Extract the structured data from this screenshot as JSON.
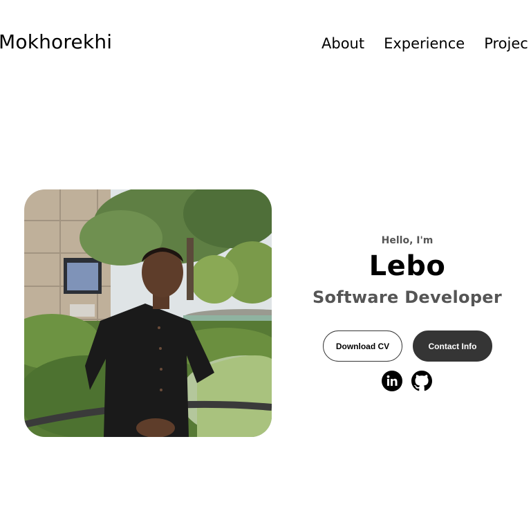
{
  "header": {
    "logo": "Mokhorekhi",
    "nav": [
      {
        "label": "About"
      },
      {
        "label": "Experience"
      },
      {
        "label": "Projec"
      }
    ]
  },
  "hero": {
    "greeting": "Hello, I'm",
    "name": "Lebo",
    "title": "Software Developer",
    "buttons": {
      "download_cv": "Download CV",
      "contact_info": "Contact Info"
    },
    "socials": [
      {
        "icon": "linkedin-icon"
      },
      {
        "icon": "github-icon"
      }
    ]
  },
  "colors": {
    "button_dark": "#353535",
    "subtitle_gray": "#555555"
  }
}
